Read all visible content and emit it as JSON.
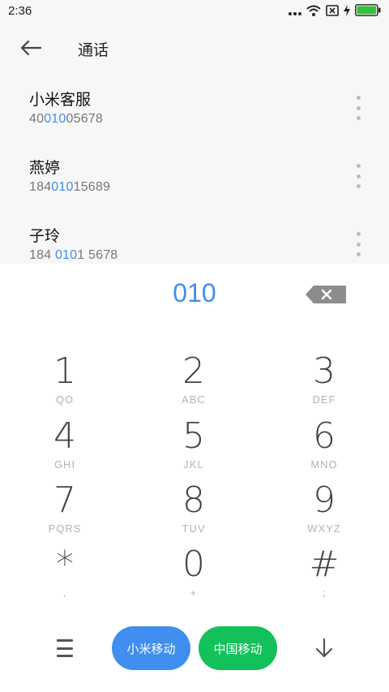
{
  "status_bar": {
    "time": "2:36",
    "icons": [
      "dots-icon",
      "wifi-icon",
      "sim-disabled-icon",
      "charging-icon",
      "battery-icon"
    ],
    "battery_color": "#35c13c"
  },
  "header": {
    "title": "通话"
  },
  "contacts": [
    {
      "name": "小米客服",
      "number_pre": "40",
      "number_match": "010",
      "number_post": "05678"
    },
    {
      "name": "燕婷",
      "number_pre": "184",
      "number_match": "010",
      "number_post": "15689"
    },
    {
      "name": "子玲",
      "number_pre": "184 ",
      "number_match": "010",
      "number_post": "1 5678"
    }
  ],
  "dialpad": {
    "dialed_number": "010",
    "keys": [
      {
        "digit": "1",
        "letters": "QO"
      },
      {
        "digit": "2",
        "letters": "ABC"
      },
      {
        "digit": "3",
        "letters": "DEF"
      },
      {
        "digit": "4",
        "letters": "GHI"
      },
      {
        "digit": "5",
        "letters": "JKL"
      },
      {
        "digit": "6",
        "letters": "MNO"
      },
      {
        "digit": "7",
        "letters": "PQRS"
      },
      {
        "digit": "8",
        "letters": "TUV"
      },
      {
        "digit": "9",
        "letters": "WXYZ"
      },
      {
        "digit": "*",
        "letters": ","
      },
      {
        "digit": "0",
        "letters": "+"
      },
      {
        "digit": "#",
        "letters": ";"
      }
    ]
  },
  "bottom_bar": {
    "sim1_label": "小米移动",
    "sim2_label": "中国移动",
    "sim1_color": "#3f8ef0",
    "sim2_color": "#12c15a",
    "accent_color": "#3f8ef0"
  }
}
